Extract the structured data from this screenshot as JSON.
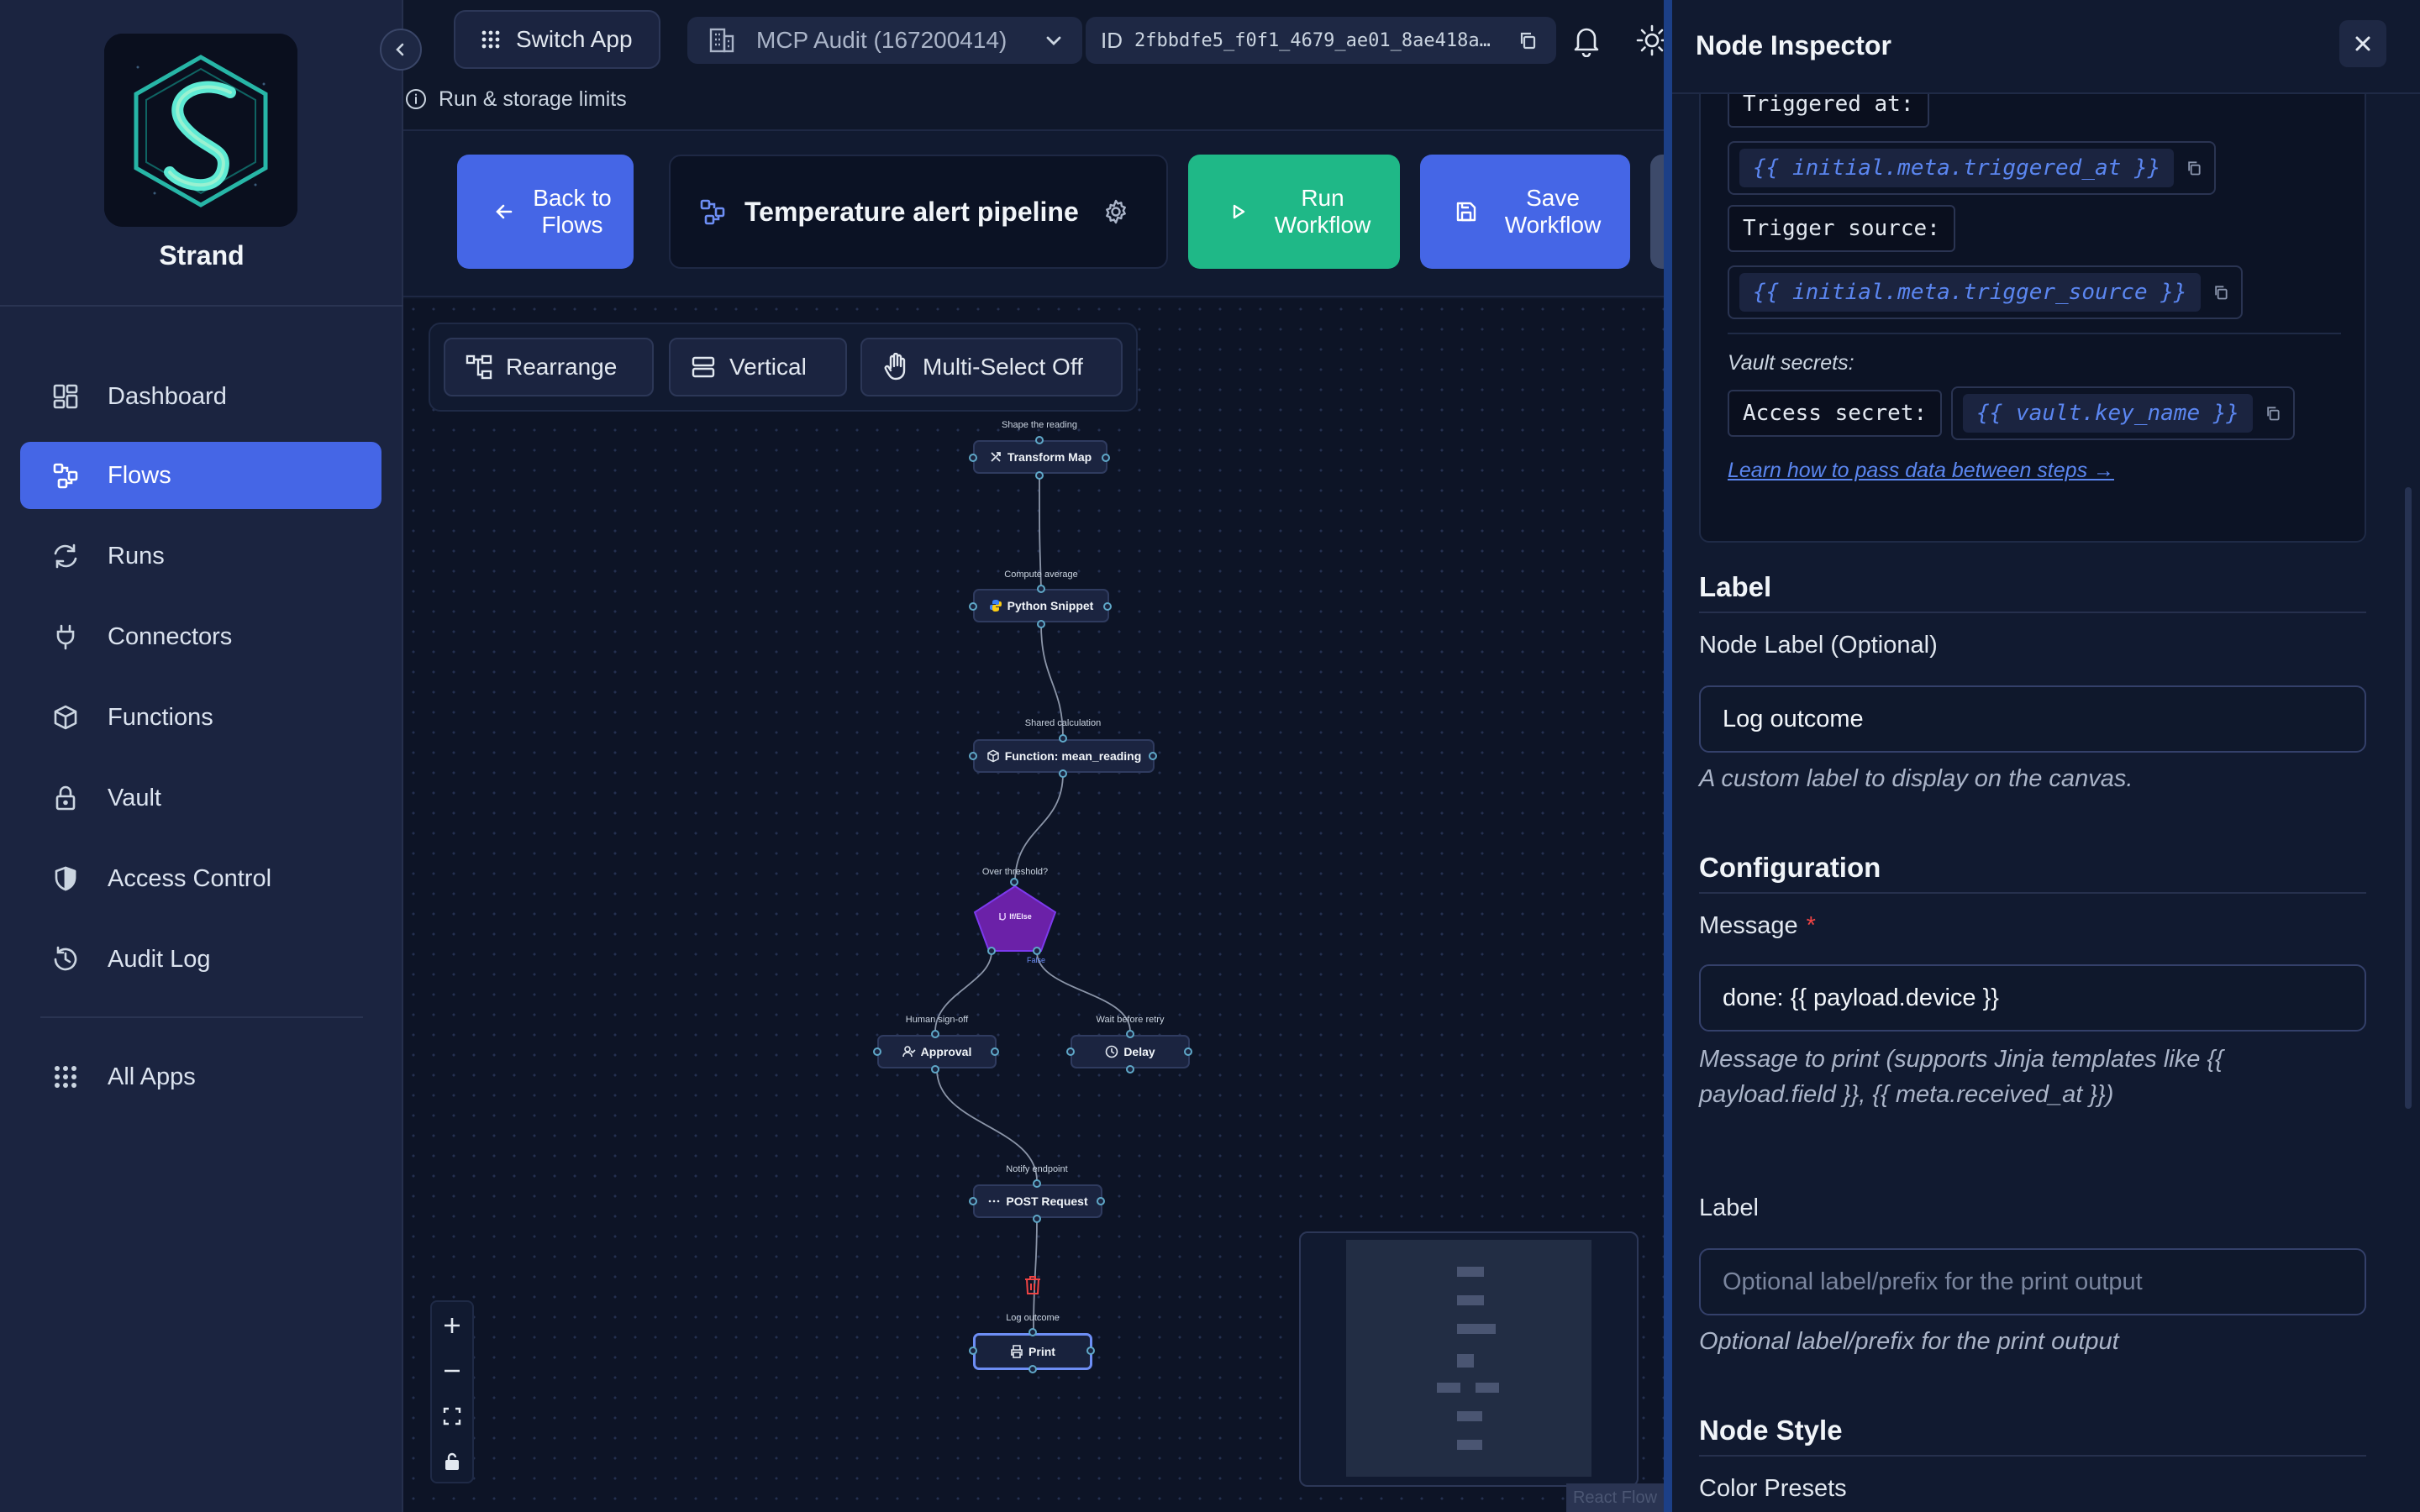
{
  "app": {
    "brand": "Strand",
    "switch_app": "Switch App",
    "workspace": "MCP Audit (167200414)",
    "id_prefix": "ID",
    "id_value": "2fbbdfe5_f0f1_4679_ae01_8ae418a…",
    "limits": "Run & storage limits"
  },
  "sidebar": {
    "items": [
      {
        "label": "Dashboard",
        "icon": "dashboard-icon"
      },
      {
        "label": "Flows",
        "icon": "flows-icon"
      },
      {
        "label": "Runs",
        "icon": "runs-icon"
      },
      {
        "label": "Connectors",
        "icon": "plug-icon"
      },
      {
        "label": "Functions",
        "icon": "cube-icon"
      },
      {
        "label": "Vault",
        "icon": "lock-icon"
      },
      {
        "label": "Access Control",
        "icon": "shield-icon"
      },
      {
        "label": "Audit Log",
        "icon": "history-icon"
      },
      {
        "label": "All Apps",
        "icon": "grid-icon"
      }
    ]
  },
  "flow_header": {
    "back": "Back to Flows",
    "title": "Temperature alert pipeline",
    "run": "Run Workflow",
    "save": "Save Workflow"
  },
  "canvas": {
    "toolbar": {
      "rearrange": "Rearrange",
      "vertical": "Vertical",
      "multiselect": "Multi-Select Off"
    },
    "nodes": [
      {
        "caption": "Shape the reading",
        "label": "Transform Map"
      },
      {
        "caption": "Compute average",
        "label": "Python Snippet"
      },
      {
        "caption": "Shared calculation",
        "label": "Function: mean_reading"
      },
      {
        "caption": "Over threshold?",
        "label": "If/Else",
        "branch": "False"
      },
      {
        "caption": "Human sign-off",
        "label": "Approval"
      },
      {
        "caption": "Wait before retry",
        "label": "Delay"
      },
      {
        "caption": "Notify endpoint",
        "label": "POST Request"
      },
      {
        "caption": "Log outcome",
        "label": "Print"
      }
    ],
    "attribution": "React Flow"
  },
  "inspector": {
    "title": "Node Inspector",
    "triggered_at_label": "Triggered at:",
    "triggered_at_tpl": "{{ initial.meta.triggered_at }}",
    "trigger_source_label": "Trigger source:",
    "trigger_source_tpl": "{{ initial.meta.trigger_source }}",
    "vault_caption": "Vault secrets:",
    "access_secret_label": "Access secret:",
    "access_secret_tpl": "{{ vault.key_name }}",
    "learn_link": "Learn how to pass data between steps →",
    "label_section": "Label",
    "node_label_field": "Node Label (Optional)",
    "node_label_value": "Log outcome",
    "node_label_help": "A custom label to display on the canvas.",
    "config_section": "Configuration",
    "message_field": "Message",
    "message_required": "*",
    "message_value": "done: {{ payload.device }}",
    "message_help": "Message to print (supports Jinja templates like {{ payload.field }}, {{ meta.received_at }})",
    "print_label_field": "Label",
    "print_label_placeholder": "Optional label/prefix for the print output",
    "print_label_help": "Optional label/prefix for the print output",
    "style_section": "Node Style",
    "color_presets": "Color Presets"
  }
}
